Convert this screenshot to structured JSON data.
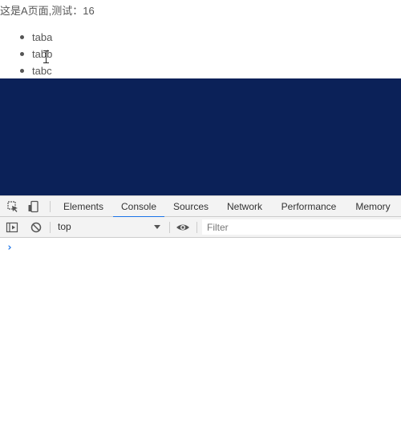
{
  "page": {
    "heading": "这是A页面,测试：16",
    "tabs": [
      "taba",
      "tabb",
      "tabc"
    ]
  },
  "colors": {
    "panel_bg": "#0b2158",
    "accent": "#1a73e8",
    "text": "#555555"
  },
  "devtools": {
    "icons": [
      "inspect-element-icon",
      "device-toolbar-icon"
    ],
    "tabs": [
      {
        "label": "Elements",
        "active": false
      },
      {
        "label": "Console",
        "active": true
      },
      {
        "label": "Sources",
        "active": false
      },
      {
        "label": "Network",
        "active": false
      },
      {
        "label": "Performance",
        "active": false
      },
      {
        "label": "Memory",
        "active": false
      }
    ],
    "toolbar": {
      "context": "top",
      "filter_placeholder": "Filter",
      "icons": [
        "show-sidebar-icon",
        "clear-console-icon",
        "eye-icon"
      ]
    },
    "prompt": "›"
  }
}
